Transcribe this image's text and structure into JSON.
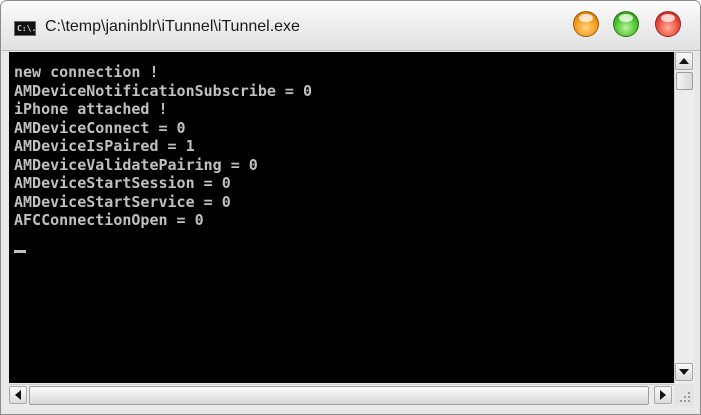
{
  "window": {
    "title": "C:\\temp\\janinblr\\iTunnel\\iTunnel.exe",
    "icon_label": "C:\\."
  },
  "console": {
    "lines": [
      "new connection !",
      "AMDeviceNotificationSubscribe = 0",
      "iPhone attached !",
      "AMDeviceConnect = 0",
      "AMDeviceIsPaired = 1",
      "AMDeviceValidatePairing = 0",
      "AMDeviceStartSession = 0",
      "AMDeviceStartService = 0",
      "AFCConnectionOpen = 0"
    ],
    "text_color": "#c0c0c0",
    "background": "#000000"
  },
  "icons": {
    "minimize": "minimize-icon",
    "maximize": "maximize-icon",
    "close": "close-icon",
    "scroll_up": "arrow-up-icon",
    "scroll_down": "arrow-down-icon",
    "scroll_left": "arrow-left-icon",
    "scroll_right": "arrow-right-icon"
  },
  "colors": {
    "minimize": "#f59a1c",
    "maximize": "#49c12a",
    "close": "#ec4a3a"
  }
}
